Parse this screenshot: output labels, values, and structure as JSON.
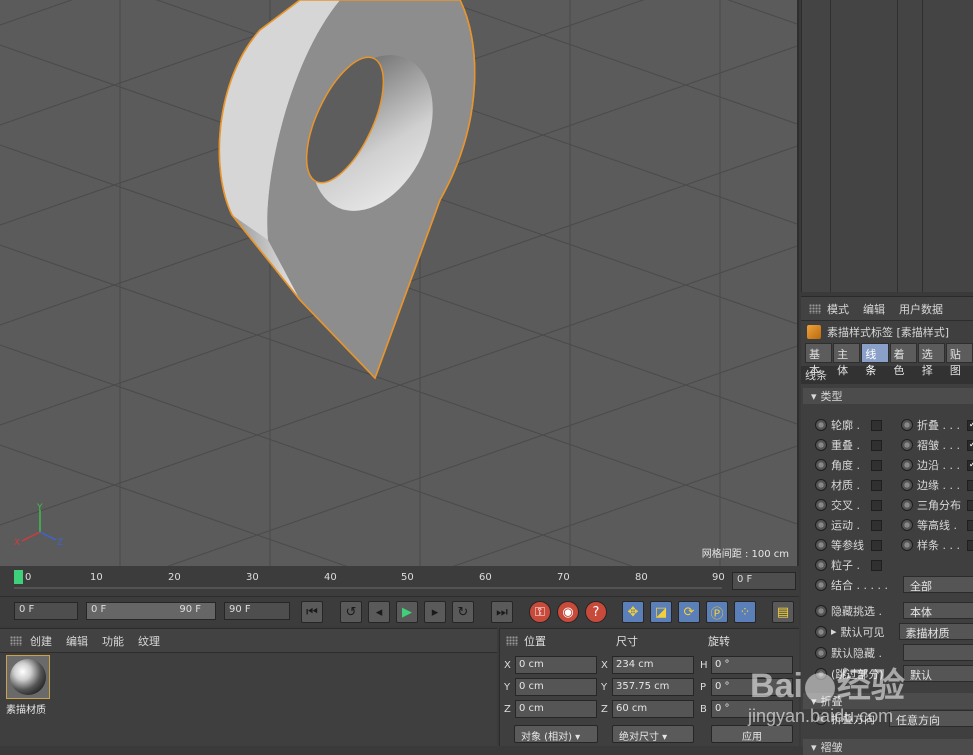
{
  "viewport": {
    "grid_spacing_label": "网格间距 : 100 cm",
    "axis_labels": [
      "Y",
      "X",
      "Z"
    ]
  },
  "attributes": {
    "menu": [
      "模式",
      "编辑",
      "用户数据"
    ],
    "tag_title": "素描样式标签 [素描样式]",
    "tabs": [
      "基本",
      "主体",
      "线条",
      "着色",
      "选择",
      "贴图"
    ],
    "active_tab": "线条",
    "section_title": "线条",
    "subsection_type": "类型",
    "left_options": [
      {
        "label": "轮廓 .",
        "checked": false
      },
      {
        "label": "重叠 .",
        "checked": false
      },
      {
        "label": "角度 .",
        "checked": false
      },
      {
        "label": "材质 .",
        "checked": false
      },
      {
        "label": "交叉 .",
        "checked": false
      },
      {
        "label": "运动 .",
        "checked": false
      },
      {
        "label": "等参线",
        "checked": false
      },
      {
        "label": "粒子 .",
        "checked": false
      }
    ],
    "right_options": [
      {
        "label": "折叠 . . .",
        "checked": true
      },
      {
        "label": "褶皱 . . .",
        "checked": true
      },
      {
        "label": "边沿 . . .",
        "checked": true
      },
      {
        "label": "边缘 . . .",
        "checked": false
      },
      {
        "label": "三角分布",
        "checked": false
      },
      {
        "label": "等高线 .",
        "checked": false
      },
      {
        "label": "样条 . . .",
        "checked": false
      }
    ],
    "combine_label": "结合 . . . . .",
    "combine_value": "全部",
    "hide_filter_label": "隐藏挑选 .",
    "hide_filter_value": "本体",
    "default_visible_label": "默认可见",
    "default_visible_value": "素描材质",
    "default_hidden_label": "默认隐藏 .",
    "default_hidden_value": "",
    "partial_label": "(跳过部分)",
    "partial_value": "默认",
    "fold_section": "折叠",
    "fold_dir_label": "折叠方向",
    "fold_dir_value": "任意方向",
    "crease_section": "褶皱"
  },
  "timeline": {
    "ticks": [
      "0",
      "10",
      "20",
      "30",
      "40",
      "50",
      "60",
      "70",
      "80",
      "90"
    ],
    "end_field": "0 F"
  },
  "transport": {
    "current_frame": "0 F",
    "range_start": "0 F",
    "range_end": "90 F",
    "max_frame": "90 F"
  },
  "material_manager": {
    "menu": [
      "创建",
      "编辑",
      "功能",
      "纹理"
    ],
    "material_name": "素描材质"
  },
  "coordinates": {
    "headers": [
      "位置",
      "尺寸",
      "旋转"
    ],
    "rows": [
      {
        "axis": "X",
        "pos": "0 cm",
        "size_axis": "X",
        "size": "234 cm",
        "rot_axis": "H",
        "rot": "0 °"
      },
      {
        "axis": "Y",
        "pos": "0 cm",
        "size_axis": "Y",
        "size": "357.75 cm",
        "rot_axis": "P",
        "rot": "0 °"
      },
      {
        "axis": "Z",
        "pos": "0 cm",
        "size_axis": "Z",
        "size": "60 cm",
        "rot_axis": "B",
        "rot": "0 °"
      }
    ],
    "mode_object": "对象 (相对)",
    "mode_size": "绝对尺寸",
    "apply": "应用"
  },
  "watermark": {
    "brand": "Bai",
    "brand2": "经验",
    "url": "jingyan.baidu.com"
  },
  "colors": {
    "viewport_bg": "#5b5b5b",
    "selection_outline": "#e8952c",
    "timeline_marker": "#3fd07a",
    "active_tab": "#8aa0c8",
    "transport_red": "#c74a3a",
    "transport_blue": "#5b7fb8"
  }
}
